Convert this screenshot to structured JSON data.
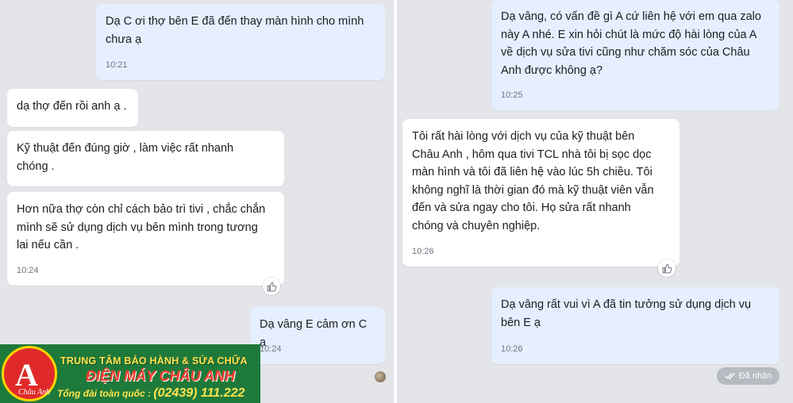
{
  "left": {
    "messages": [
      {
        "dir": "out",
        "lines": [
          "Dạ C ơi thợ bên E đã đến thay màn hình cho mình",
          "chưa ạ"
        ],
        "time": "10:21"
      },
      {
        "dir": "in",
        "lines": [
          "dạ thợ đến rồi anh ạ ."
        ]
      },
      {
        "dir": "in",
        "lines": [
          "Kỹ thuật đến đúng giờ , làm việc rất nhanh",
          "chóng ."
        ]
      },
      {
        "dir": "in",
        "lines": [
          "Hơn nữa thợ còn chỉ cách bảo trì tivi , chắc chắn",
          "mình sẽ sử dụng dịch vụ bên mình trong tương",
          "lai nếu cần ."
        ],
        "time": "10:24"
      },
      {
        "dir": "out",
        "lines": [
          "Dạ vâng E cảm ơn C ạ"
        ],
        "time": "10:24"
      }
    ]
  },
  "right": {
    "messages": [
      {
        "dir": "out",
        "lines": [
          "Dạ vâng, có vấn đề gì A cứ liên hệ với em qua zalo",
          "này A nhé. E xin hỏi chút là mức độ hài lòng của A",
          "về dịch vụ sửa tivi cũng như chăm sóc của Châu",
          "Anh được không ạ?"
        ],
        "time": "10:25"
      },
      {
        "dir": "in",
        "lines": [
          "Tôi rất hài lòng với dịch vụ của kỹ thuật bên",
          "Châu Anh , hôm qua tivi TCL nhà tôi bị sọc dọc",
          "màn hình và tôi đã liên hệ vào lúc 5h chiều. Tôi",
          "không nghĩ là thời gian đó mà kỹ thuật viên vẫn",
          "đến và sửa ngay cho tôi. Họ sửa rất nhanh",
          "chóng và chuyên nghiệp."
        ],
        "time": "10:26"
      },
      {
        "dir": "out",
        "lines": [
          "Dạ vâng rất vui vì A đã tin tưởng sử dụng dịch vụ",
          "bên E ạ"
        ],
        "time": "10:26"
      }
    ],
    "status_label": "Đã nhận"
  },
  "banner": {
    "line1": "TRUNG TÂM BẢO HÀNH & SỬA CHỮA",
    "line2": "ĐIỆN MÁY CHÂU ANH",
    "line3_prefix": "Tổng đài toàn quốc : ",
    "phone": "(02439) 111.222",
    "logo_text": "Châu Anh"
  },
  "icons": {
    "like": "thumbs-up-icon",
    "received": "double-check-icon"
  },
  "colors": {
    "incoming": "#ffffff",
    "outgoing": "#e5efff",
    "background": "#e3e5e9",
    "status_badge": "#b6bbc2"
  }
}
